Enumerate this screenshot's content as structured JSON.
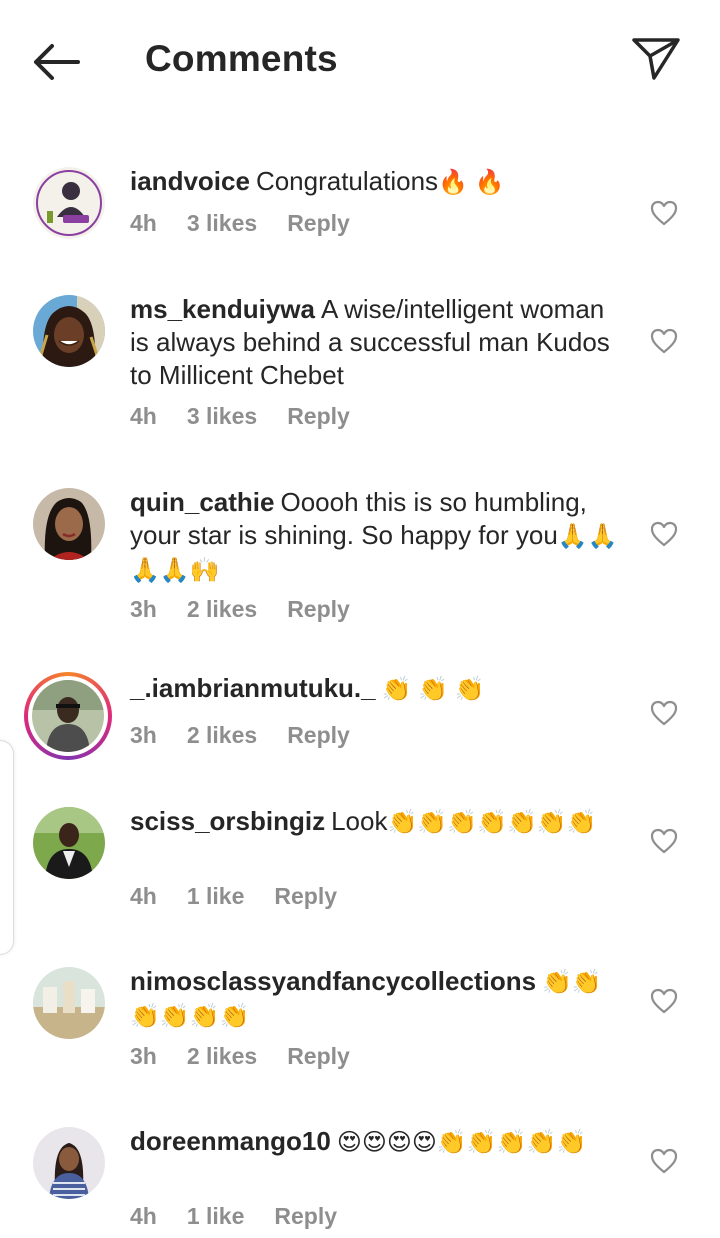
{
  "header": {
    "title": "Comments",
    "back_icon": "arrow-left-icon",
    "share_icon": "paper-plane-icon"
  },
  "comments": [
    {
      "username": "iandvoice",
      "text": "Congratulations",
      "emoji": "🔥 🔥",
      "time": "4h",
      "likes": "3 likes",
      "reply": "Reply"
    },
    {
      "username": "ms_kenduiywa",
      "text": "A wise/intelligent woman is always behind a successful man Kudos to Millicent Chebet",
      "emoji": "",
      "time": "4h",
      "likes": "3 likes",
      "reply": "Reply"
    },
    {
      "username": "quin_cathie",
      "text": "Ooooh this is so humbling, your star is shining. So happy for you",
      "emoji": "🙏🙏🙏🙏🙌",
      "time": "3h",
      "likes": "2 likes",
      "reply": "Reply"
    },
    {
      "username": "_.iambrianmutuku._",
      "text": "",
      "emoji": "👏 👏 👏",
      "time": "3h",
      "likes": "2 likes",
      "reply": "Reply"
    },
    {
      "username": "sciss_orsbingiz",
      "text": "Look",
      "emoji": "👏👏👏👏👏👏👏",
      "time": "4h",
      "likes": "1 like",
      "reply": "Reply"
    },
    {
      "username": "nimosclassyandfancycollections",
      "text": "",
      "emoji": "👏👏👏👏👏👏",
      "time": "3h",
      "likes": "2 likes",
      "reply": "Reply"
    },
    {
      "username": "doreenmango10",
      "text": "",
      "emoji": "😍😍😍😍👏👏👏👏👏",
      "time": "4h",
      "likes": "1 like",
      "reply": "Reply"
    }
  ],
  "icons": {
    "like": "heart-outline-icon"
  },
  "colors": {
    "text": "#262626",
    "meta": "#8e8e8e",
    "story_ring": "#dd2a7b"
  }
}
